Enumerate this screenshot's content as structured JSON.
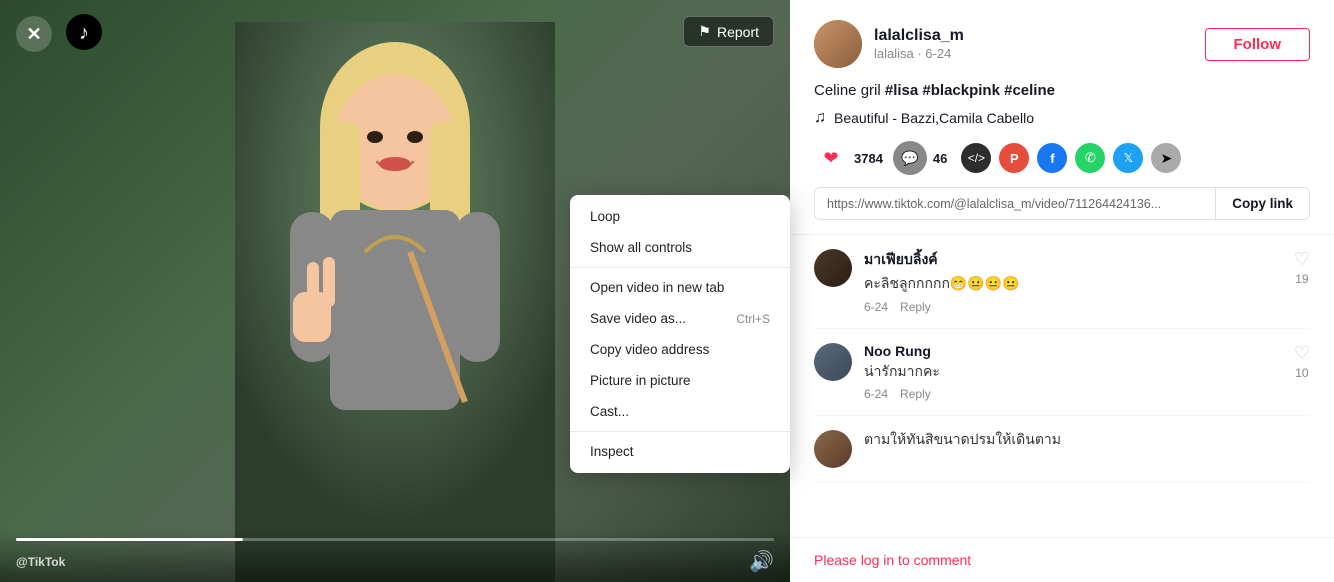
{
  "video": {
    "close_label": "✕",
    "report_label": "Report",
    "watermark": "@TikTok",
    "progress_percent": 30
  },
  "context_menu": {
    "items": [
      {
        "label": "Loop",
        "shortcut": ""
      },
      {
        "label": "Show all controls",
        "shortcut": ""
      },
      {
        "divider": true
      },
      {
        "label": "Open video in new tab",
        "shortcut": ""
      },
      {
        "label": "Save video as...",
        "shortcut": "Ctrl+S"
      },
      {
        "label": "Copy video address",
        "shortcut": ""
      },
      {
        "label": "Picture in picture",
        "shortcut": ""
      },
      {
        "label": "Cast...",
        "shortcut": ""
      },
      {
        "divider": true
      },
      {
        "label": "Inspect",
        "shortcut": ""
      }
    ]
  },
  "post": {
    "username": "lalalclisa_m",
    "sub_info": "lalalisa · 6-24",
    "follow_label": "Follow",
    "caption_plain": "Celine gril ",
    "caption_tags": "#lisa #blackpink #celine",
    "music_note": "♫",
    "music": "Beautiful - Bazzi,Camila Cabello",
    "likes_count": "3784",
    "comments_count": "46",
    "link_url": "https://www.tiktok.com/@lalalclisa_m/video/711264424136...",
    "copy_link_label": "Copy link"
  },
  "comments": [
    {
      "username": "มาเฟียบลิ้งค์",
      "text": "คะลิชลูกกกกก😁😐😐😐",
      "date": "6-24",
      "reply_label": "Reply",
      "likes": "19"
    },
    {
      "username": "Noo Rung",
      "text": "น่ารักมากคะ",
      "date": "6-24",
      "reply_label": "Reply",
      "likes": "10"
    },
    {
      "username": "",
      "text": "ตามให้ทันสิขนาดปรมให้เดินตาม",
      "date": "",
      "reply_label": "",
      "likes": ""
    }
  ],
  "login_prompt": "Please log in to comment"
}
